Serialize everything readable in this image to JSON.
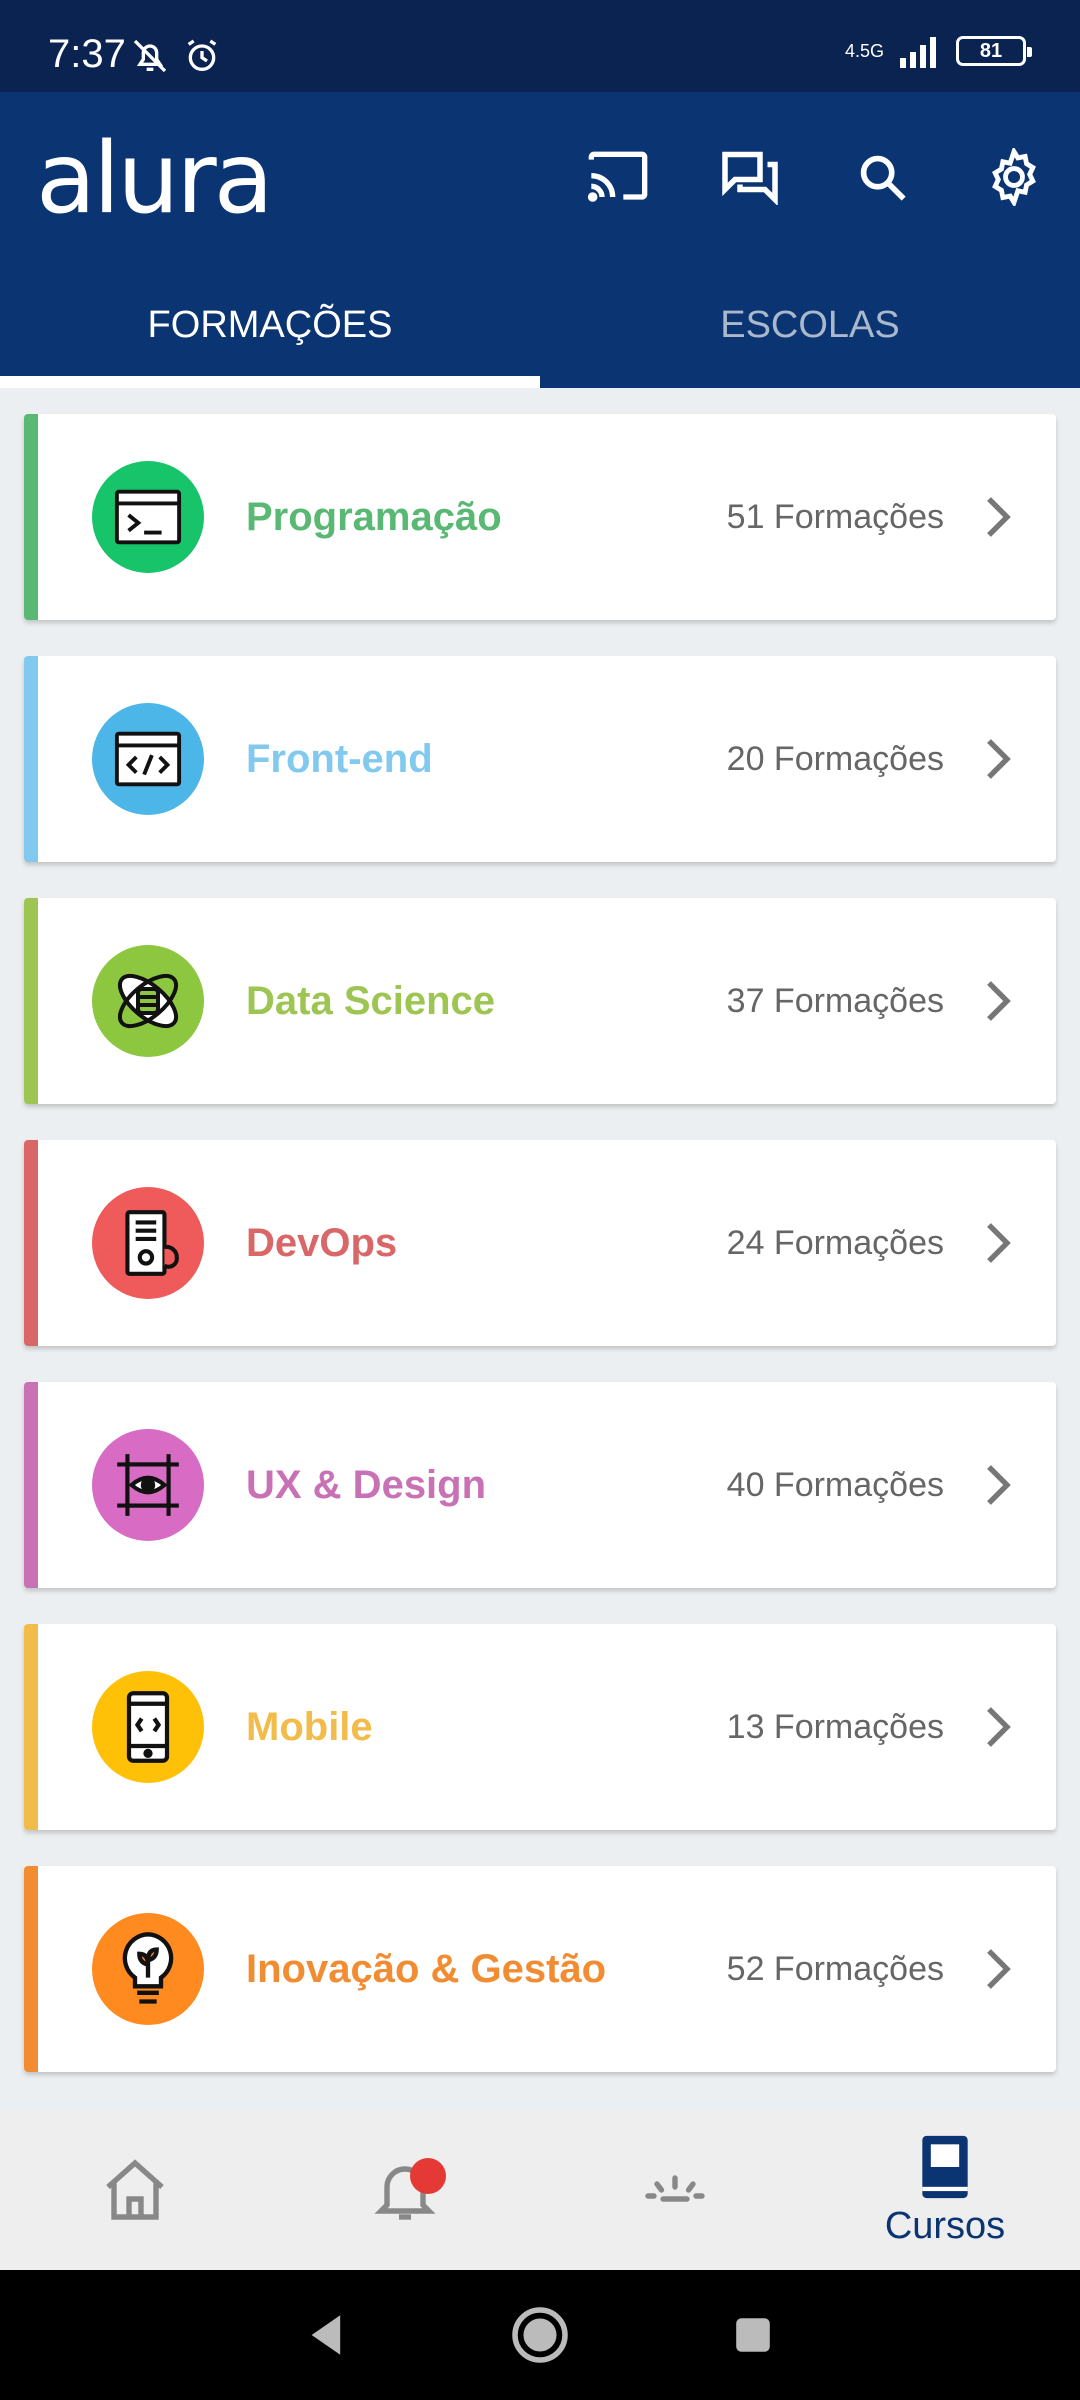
{
  "status_bar": {
    "time": "7:37",
    "network": "4.5G",
    "battery": "81"
  },
  "app": {
    "logo": "alura",
    "tabs": [
      {
        "label": "FORMAÇÕES"
      },
      {
        "label": "ESCOLAS"
      }
    ]
  },
  "categories": [
    {
      "title": "Programação",
      "count": "51 Formações",
      "color": "#5ab875",
      "icon_bg": "#17c46a",
      "icon": "terminal-icon"
    },
    {
      "title": "Front-end",
      "count": "20 Formações",
      "color": "#81c9ee",
      "icon_bg": "#4db6e8",
      "icon": "code-window-icon"
    },
    {
      "title": "Data Science",
      "count": "37 Formações",
      "color": "#9dc552",
      "icon_bg": "#8dc63f",
      "icon": "atom-icon"
    },
    {
      "title": "DevOps",
      "count": "24 Formações",
      "color": "#d96767",
      "icon_bg": "#ef5b5b",
      "icon": "server-icon"
    },
    {
      "title": "UX & Design",
      "count": "40 Formações",
      "color": "#c971b5",
      "icon_bg": "#d86bc4",
      "icon": "eye-icon"
    },
    {
      "title": "Mobile",
      "count": "13 Formações",
      "color": "#f1bc4a",
      "icon_bg": "#ffc107",
      "icon": "smartphone-icon"
    },
    {
      "title": "Inovação & Gestão",
      "count": "52 Formações",
      "color": "#f28c32",
      "icon_bg": "#ff8a20",
      "icon": "lightbulb-icon"
    }
  ],
  "bottom_nav": {
    "courses_label": "Cursos"
  }
}
